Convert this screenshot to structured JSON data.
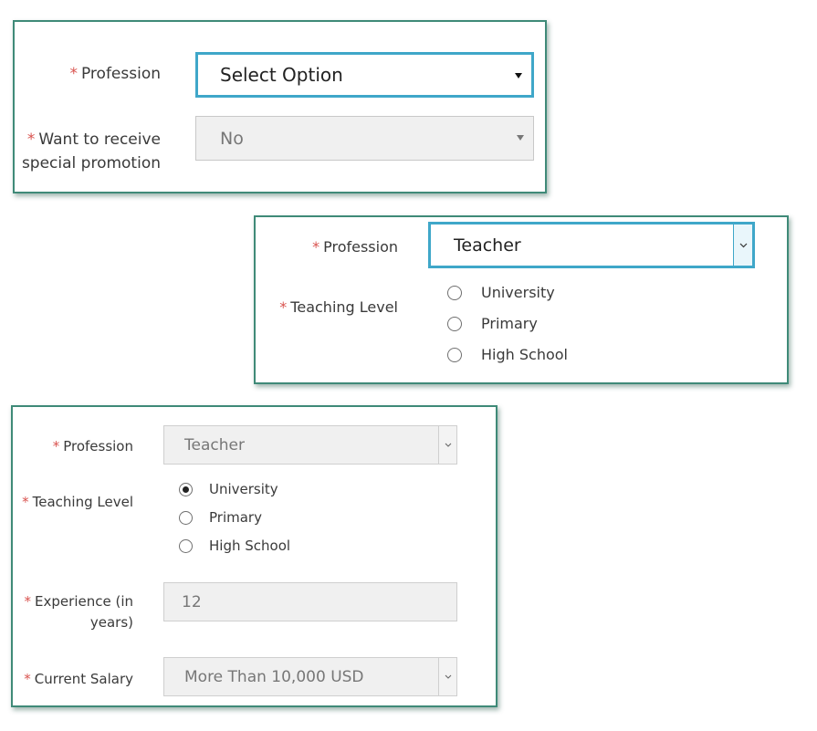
{
  "required_marker": "*",
  "panel1": {
    "profession_label": "Profession",
    "profession_value": "Select Option",
    "promotion_label_line1": "Want to receive",
    "promotion_label_line2": "special promotion",
    "promotion_value": "No"
  },
  "panel2": {
    "profession_label": "Profession",
    "profession_value": "Teacher",
    "teaching_level_label": "Teaching Level",
    "options": [
      "University",
      "Primary",
      "High School"
    ],
    "selected_option": null
  },
  "panel3": {
    "profession_label": "Profession",
    "profession_value": "Teacher",
    "teaching_level_label": "Teaching Level",
    "options": [
      "University",
      "Primary",
      "High School"
    ],
    "selected_option": "University",
    "experience_label_line1": "Experience (in",
    "experience_label_line2": "years)",
    "experience_value": "12",
    "salary_label": "Current Salary",
    "salary_value": "More Than 10,000 USD"
  },
  "colors": {
    "panel_border": "#3f8a78",
    "focus_border": "#3fa7c9",
    "required": "#d9534f",
    "disabled_bg": "#f0f0f0"
  },
  "icons": {
    "dropdown_solid": "triangle-down-icon",
    "dropdown_chevron": "chevron-down-icon"
  }
}
